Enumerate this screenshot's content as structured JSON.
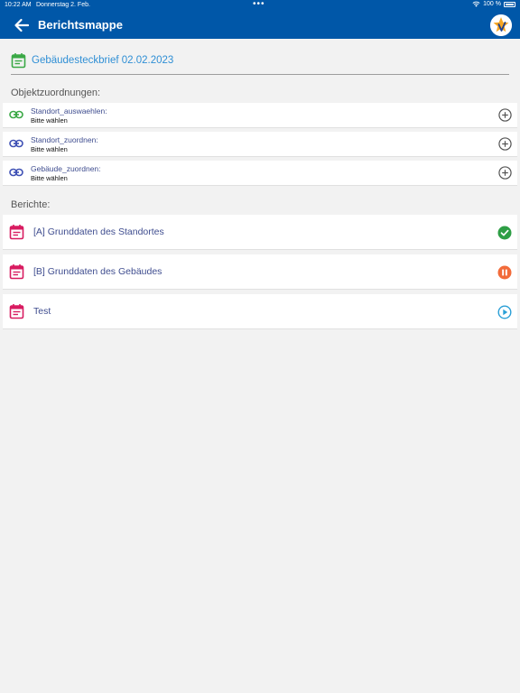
{
  "statusbar": {
    "time": "10:22 AM",
    "date": "Donnerstag 2. Feb.",
    "dots": "•••",
    "battery_text": "100 %"
  },
  "header": {
    "title": "Berichtsmappe",
    "back_icon": "arrow-left-icon",
    "logo_icon": "star-v-logo",
    "color": "#0057a8"
  },
  "document": {
    "icon": "calendar-icon",
    "title": "Gebäudesteckbrief 02.02.2023",
    "color": "#2f8fd5"
  },
  "assignments": {
    "heading": "Objektzuordnungen:",
    "items": [
      {
        "label": "Standort_auswaehlen:",
        "value": "Bitte wählen",
        "icon_color": "#3aa845"
      },
      {
        "label": "Standort_zuordnen:",
        "value": "Bitte wählen",
        "icon_color": "#3f51b5"
      },
      {
        "label": "Gebäude_zuordnen:",
        "value": "Bitte wählen",
        "icon_color": "#3f51b5"
      }
    ]
  },
  "reports": {
    "heading": "Berichte:",
    "items": [
      {
        "label": "[A] Grunddaten des Standortes",
        "status": "completed",
        "status_color": "#2e9e45"
      },
      {
        "label": "[B] Grunddaten des Gebäudes",
        "status": "paused",
        "status_color": "#f26b3a"
      },
      {
        "label": "Test",
        "status": "play",
        "status_color": "#2a9fd6"
      }
    ]
  }
}
